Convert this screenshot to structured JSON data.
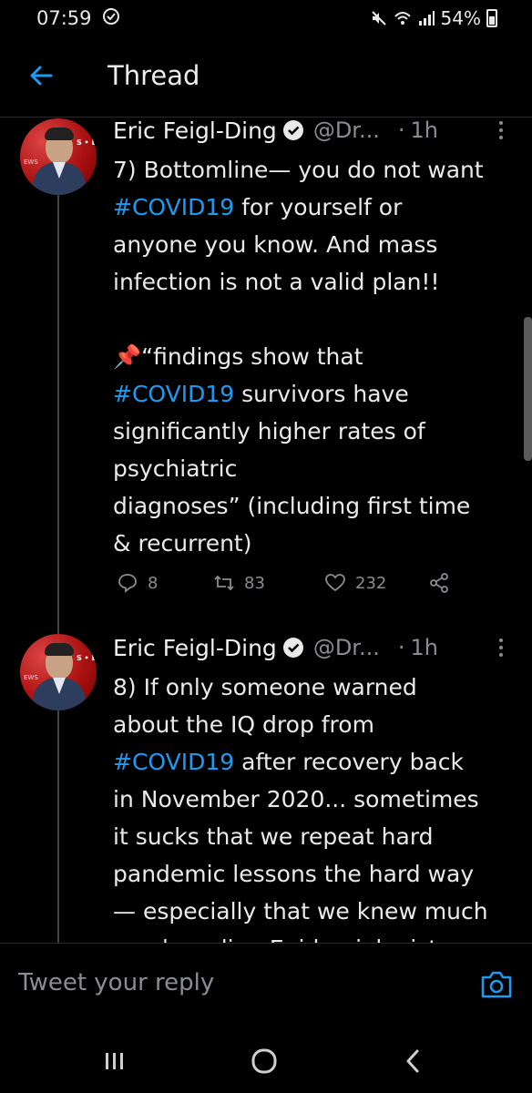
{
  "status_bar": {
    "time": "07:59",
    "battery": "54%"
  },
  "header": {
    "title": "Thread"
  },
  "tweets": [
    {
      "author": "Eric Feigl-Ding",
      "handle": "@Dr...",
      "separator": "·",
      "time": "1h",
      "text_parts": [
        {
          "t": "7) Bottomline— you do not want\n"
        },
        {
          "t": "#COVID19",
          "tag": true
        },
        {
          "t": " for yourself or\nanyone you know. And mass\ninfection is not a valid plan!!\n\n📌“findings show that\n"
        },
        {
          "t": "#COVID19",
          "tag": true
        },
        {
          "t": " survivors have\nsignificantly higher rates of\npsychiatric\ndiagnoses” (including first time\n& recurrent)"
        }
      ],
      "replies": "8",
      "retweets": "83",
      "likes": "232"
    },
    {
      "author": "Eric Feigl-Ding",
      "handle": "@Dr...",
      "separator": "·",
      "time": "1h",
      "text_parts": [
        {
          "t": "8) If only someone warned\nabout the IQ drop from\n"
        },
        {
          "t": "#COVID19",
          "tag": true
        },
        {
          "t": " after recovery back\nin November 2020... sometimes\nit sucks that we repeat hard\npandemic lessons the hard way\n— especially that we knew much\nmuch earlier. Epidemiologists"
        }
      ]
    }
  ],
  "reply_bar": {
    "placeholder": "Tweet your reply"
  },
  "colors": {
    "accent": "#1d9bf0",
    "secondary_text": "#8a8d91",
    "background": "#000000"
  }
}
